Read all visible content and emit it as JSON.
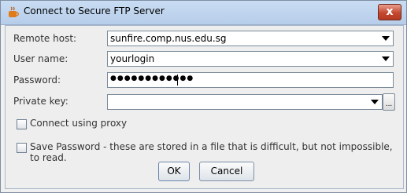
{
  "window": {
    "title": "Connect to Secure FTP Server",
    "close_label": "x"
  },
  "form": {
    "remote_host": {
      "label": "Remote host:",
      "value": "sunfire.comp.nus.edu.sg"
    },
    "user_name": {
      "label": "User name:",
      "value": "yourlogin"
    },
    "password": {
      "label": "Password:",
      "masked": "●●●●●●●●●●●●"
    },
    "private_key": {
      "label": "Private key:",
      "value": "",
      "browse_label": "..."
    }
  },
  "options": {
    "proxy_label": "Connect using proxy",
    "save_password_label": "Save Password - these are stored in a file that is difficult, but not impossible, to read."
  },
  "buttons": {
    "ok": "OK",
    "cancel": "Cancel"
  }
}
